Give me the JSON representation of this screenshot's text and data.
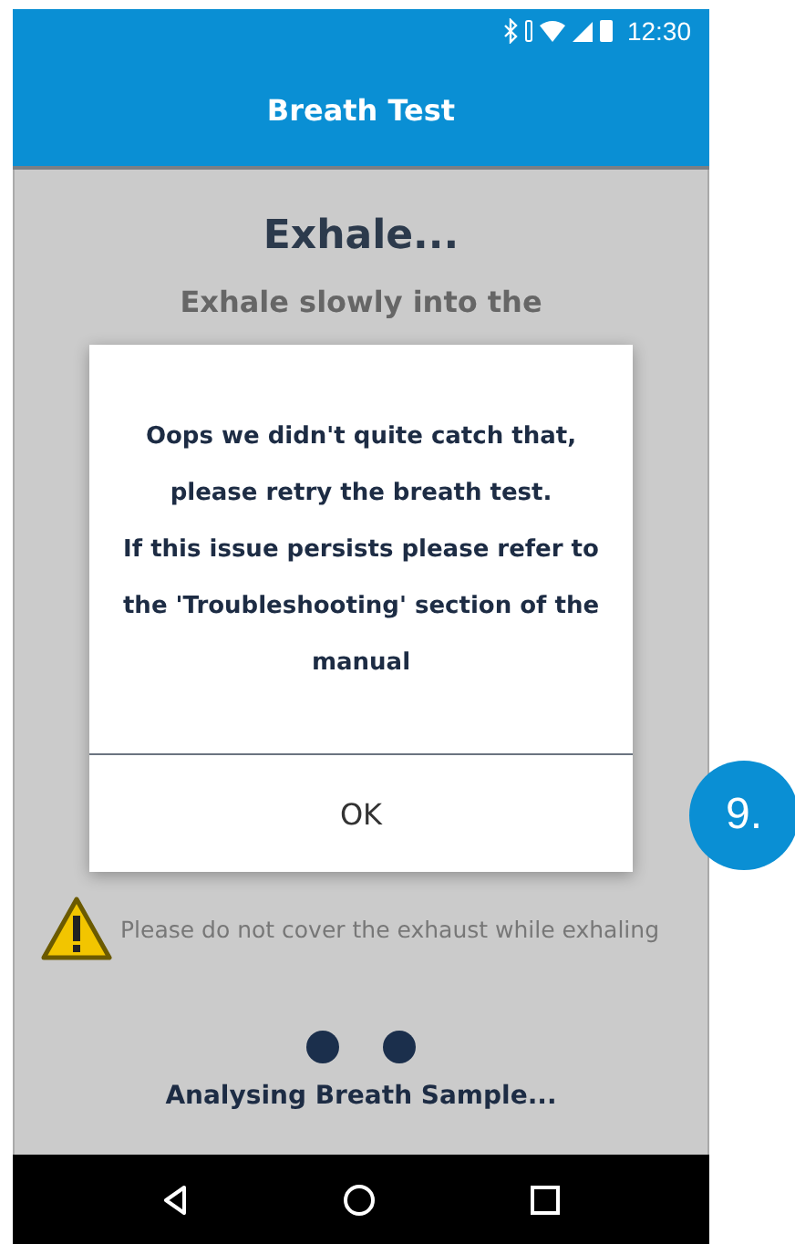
{
  "status_bar": {
    "time": "12:30"
  },
  "app_bar": {
    "title": "Breath Test"
  },
  "screen": {
    "heading": "Exhale...",
    "instruction": "Exhale slowly into the",
    "warning": "Please do not cover the exhaust while exhaling",
    "progress_text": "Analysing Breath Sample..."
  },
  "dialog": {
    "lines": [
      "Oops we didn't quite catch that,",
      "please retry the breath test.",
      "If this issue persists please refer to",
      "the 'Troubleshooting' section of the",
      "manual"
    ],
    "button": "OK"
  },
  "step_badge": "9."
}
